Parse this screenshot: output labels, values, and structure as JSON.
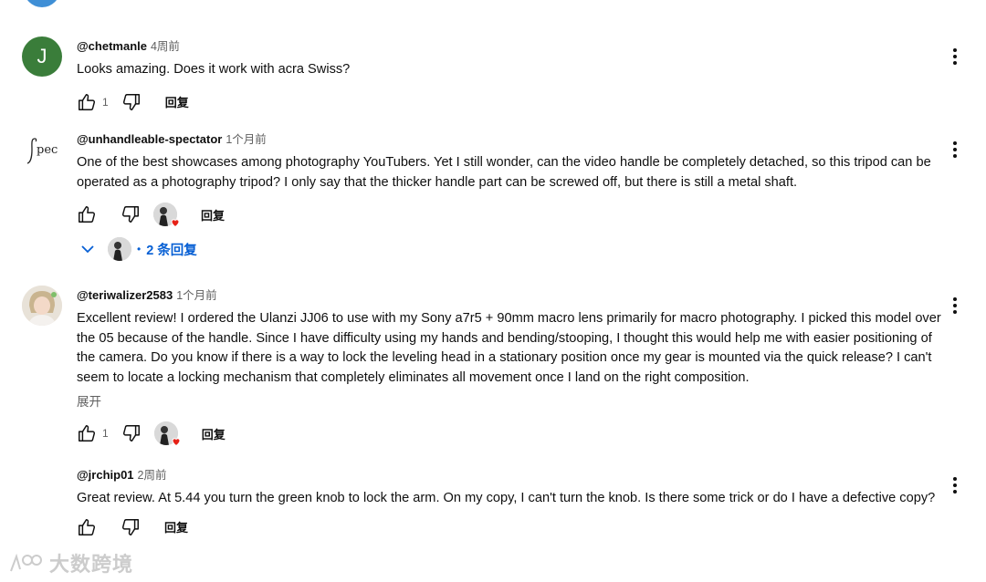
{
  "comments": [
    {
      "avatar_letter": "J",
      "author": "@chetmanle",
      "time": "4周前",
      "text": "Looks amazing. Does it work with acra Swiss?",
      "likes": "1",
      "reply_label": "回复"
    },
    {
      "avatar_text": "∫pec",
      "author": "@unhandleable-spectator",
      "time": "1个月前",
      "text": "One of the best showcases among photography YouTubers. Yet I still wonder, can the video handle be completely detached, so this tripod can be operated as a photography tripod? I only say that the thicker handle part can be screwed off, but there is still a metal shaft.",
      "likes": "",
      "reply_label": "回复",
      "replies_label": "2 条回复"
    },
    {
      "author": "@teriwalizer2583",
      "time": "1个月前",
      "text": "Excellent review! I ordered the Ulanzi JJ06 to use with my Sony a7r5 + 90mm macro lens primarily for macro photography. I picked this model over the 05 because of the handle. Since I have difficulty using my hands and bending/stooping, I thought this would help me with easier positioning of the camera. Do you know if there is a way to lock the leveling head in a stationary position once my gear is mounted via the quick release? I can't seem to locate a locking mechanism that completely eliminates all movement once I land on the right composition.",
      "expand_label": "展开",
      "likes": "1",
      "reply_label": "回复"
    },
    {
      "author": "@jrchip01",
      "time": "2周前",
      "text": "Great review. At 5.44 you turn the green knob to lock the arm. On my copy, I can't turn the knob. Is there some trick or do I have a defective copy?",
      "likes": "",
      "reply_label": "回复"
    }
  ],
  "watermark": {
    "text": "大数跨境"
  },
  "colors": {
    "link_blue": "#065fd4",
    "secondary_text": "#606060",
    "heart_red": "#e62117",
    "avatar_green": "#3a7d3a"
  }
}
